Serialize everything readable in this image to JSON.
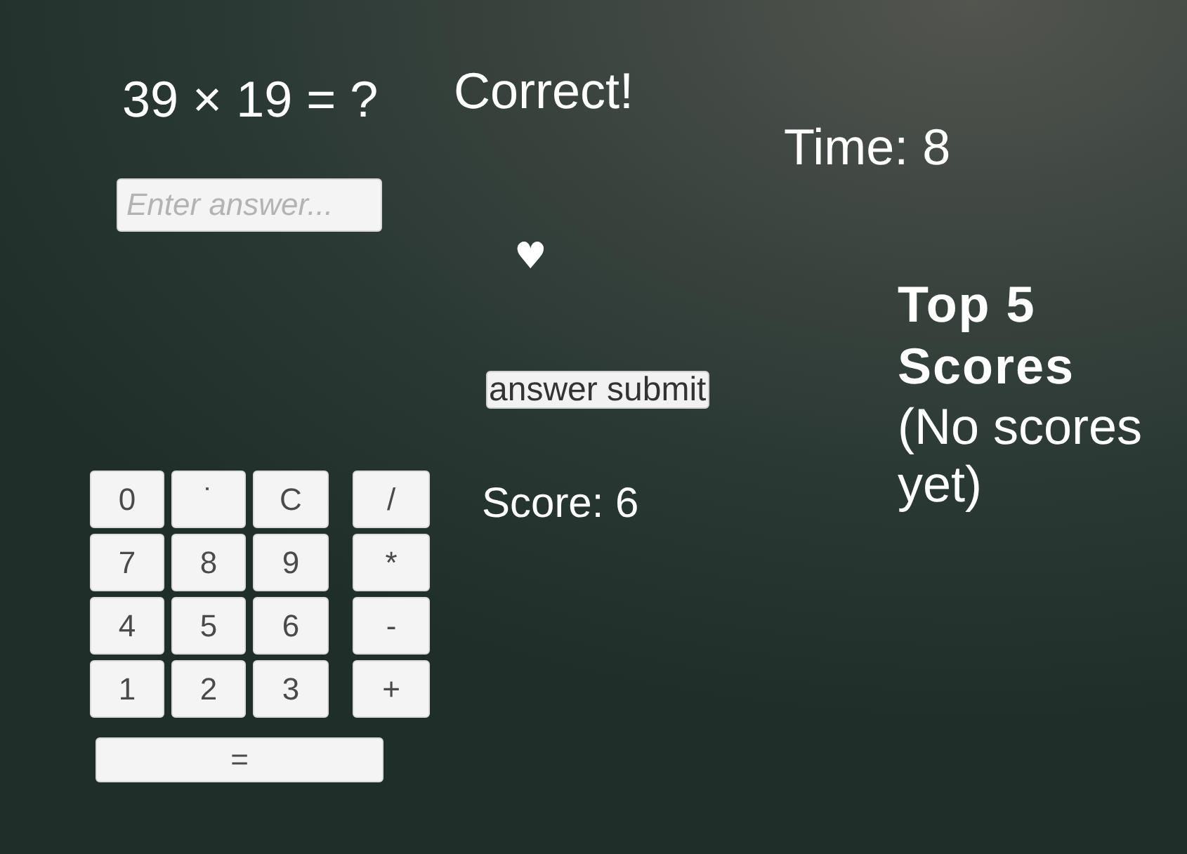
{
  "question": "39 × 19 = ?",
  "answer_field": {
    "placeholder": "Enter answer..."
  },
  "keypad": {
    "rows": [
      [
        "0",
        "˙",
        "C",
        "/"
      ],
      [
        "7",
        "8",
        "9",
        "*"
      ],
      [
        "4",
        "5",
        "6",
        "-"
      ],
      [
        "1",
        "2",
        "3",
        "+"
      ]
    ],
    "equals": "="
  },
  "feedback": "Correct!",
  "lives": "♥",
  "submit_button": "answer submit",
  "score": "Score: 6",
  "time": "Time: 8",
  "leaderboard": {
    "title": "Top 5 Scores",
    "empty_message": "(No scores yet)"
  }
}
